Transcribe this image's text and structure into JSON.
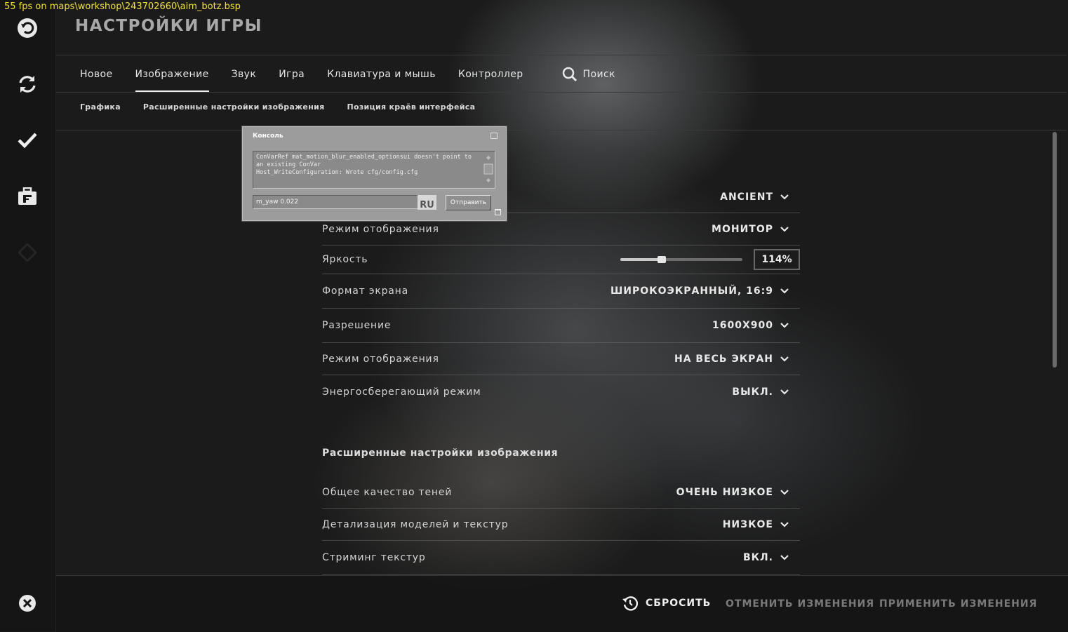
{
  "fps_text": "55 fps on maps\\workshop\\243702660\\aim_botz.bsp",
  "title": "НАСТРОЙКИ ИГРЫ",
  "sidebar": {
    "items": [
      {
        "icon": "undo-icon"
      },
      {
        "icon": "refresh-icon"
      },
      {
        "icon": "checkmark-icon"
      },
      {
        "icon": "briefcase-icon"
      },
      {
        "icon": "diamond-icon"
      },
      {
        "icon": "close-icon"
      }
    ]
  },
  "tabs": [
    {
      "label": "Новое"
    },
    {
      "label": "Изображение",
      "active": true
    },
    {
      "label": "Звук"
    },
    {
      "label": "Игра"
    },
    {
      "label": "Клавиатура и мышь"
    },
    {
      "label": "Контроллер"
    }
  ],
  "search_label": "Поиск",
  "subtabs": [
    {
      "label": "Графика"
    },
    {
      "label": "Расширенные настройки изображения"
    },
    {
      "label": "Позиция краёв интерфейса"
    }
  ],
  "settings": [
    {
      "label": "",
      "value": "ANCIENT"
    },
    {
      "label": "Режим отображения",
      "value": "МОНИТОР"
    },
    {
      "label": "Яркость",
      "value": "114%",
      "slider_fraction": 0.34
    },
    {
      "label": "Формат экрана",
      "value": "ШИРОКОЭКРАННЫЙ, 16:9"
    },
    {
      "label": "Разрешение",
      "value": "1600X900"
    },
    {
      "label": "Режим отображения",
      "value": "НА ВЕСЬ ЭКРАН"
    },
    {
      "label": "Энергосберегающий режим",
      "value": "ВЫКЛ."
    }
  ],
  "advanced_title": "Расширенные настройки изображения",
  "advanced": [
    {
      "label": "Общее качество теней",
      "value": "ОЧЕНЬ НИЗКОЕ"
    },
    {
      "label": "Детализация моделей и текстур",
      "value": "НИЗКОЕ"
    },
    {
      "label": "Стриминг текстур",
      "value": "ВКЛ."
    }
  ],
  "footer": {
    "reset": "СБРОСИТЬ",
    "cancel": "ОТМЕНИТЬ ИЗМЕНЕНИЯ",
    "apply": "ПРИМЕНИТЬ ИЗМЕНЕНИЯ"
  },
  "console": {
    "title": "Консоль",
    "log": "ConVarRef mat_motion_blur_enabled_optionsui doesn't point to an existing ConVar\nHost_WriteConfiguration: Wrote cfg/config.cfg",
    "input_value": "m_yaw 0.022",
    "lang": "RU",
    "send": "Отправить"
  },
  "colors": {
    "fps_text": "#f0e040",
    "accent": "#f0f0f0",
    "disabled_text": "#7a7a7a"
  }
}
